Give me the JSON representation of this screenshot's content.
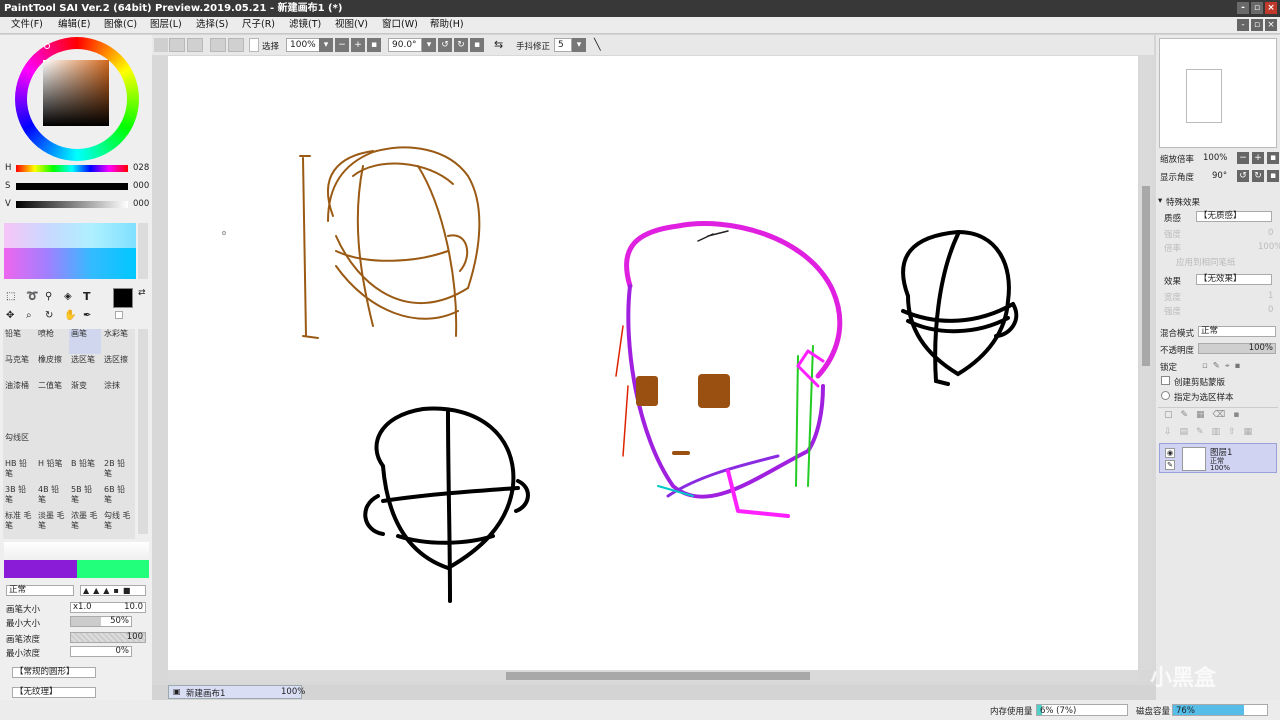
{
  "window": {
    "title": "PaintTool SAI Ver.2 (64bit) Preview.2019.05.21 - 新建画布1 (*)",
    "btn_min": "-",
    "btn_max": "▫",
    "btn_close": "×"
  },
  "menu": [
    "文件(F)",
    "编辑(E)",
    "图像(C)",
    "图层(L)",
    "选择(S)",
    "尺子(R)",
    "滤镜(T)",
    "视图(V)",
    "窗口(W)",
    "帮助(H)"
  ],
  "toolbar": {
    "select_label": "选择",
    "zoom": "100%",
    "rotation": "90.0°",
    "stabilizer_label": "手抖修正",
    "stabilizer": "5"
  },
  "color": {
    "h_label": "H",
    "s_label": "S",
    "v_label": "V",
    "h_value": "028",
    "s_value": "000",
    "v_value": "000"
  },
  "tools": {
    "text_tool": "T",
    "row1": [
      "铅笔",
      "喷枪",
      "画笔",
      "水彩笔"
    ],
    "row2": [
      "马克笔",
      "橡皮擦",
      "选区笔",
      "选区擦"
    ],
    "row3": [
      "油漆桶",
      "二值笔",
      "渐变",
      "涂抹"
    ],
    "row4": [
      "勾线区"
    ],
    "row5": [
      "HB 铅笔",
      "H 铅笔",
      "B 铅笔",
      "2B 铅笔"
    ],
    "row6": [
      "3B 铅笔",
      "4B 铅笔",
      "5B 铅笔",
      "6B 铅笔"
    ],
    "row7": [
      "标准 毛笔",
      "淡墨 毛笔",
      "浓墨 毛笔",
      "勾线 毛笔"
    ]
  },
  "brush": {
    "mode": "正常",
    "size_label": "画笔大小",
    "size_mult": "x1.0",
    "size_value": "10.0",
    "min_size_label": "最小大小",
    "min_size": "50%",
    "density_label": "画笔浓度",
    "density": "100",
    "min_density_label": "最小浓度",
    "min_density": "0%",
    "shape": "【常规的圆形】",
    "texture": "【无纹理】",
    "swatch_colors": [
      "#8a1bd6",
      "#22ff7a"
    ]
  },
  "navigator": {
    "zoom_label": "缩放倍率",
    "zoom": "100%",
    "angle_label": "显示角度",
    "angle": "90°"
  },
  "effects": {
    "header": "特殊效果",
    "texture_label": "质感",
    "texture": "【无质感】",
    "texture_sub": [
      "强度",
      "倍率",
      "应用到相同笔纸"
    ],
    "texture_vals": [
      "0",
      "100%"
    ],
    "effect_label": "效果",
    "effect": "【无效果】",
    "effect_sub": [
      "宽度",
      "强度"
    ],
    "effect_vals": [
      "1",
      "0"
    ]
  },
  "layer": {
    "blend_label": "混合模式",
    "blend": "正常",
    "opacity_label": "不透明度",
    "opacity": "100%",
    "lock_label": "锁定",
    "clip_label": "创建剪贴蒙版",
    "ref_label": "指定为选区样本",
    "name": "图层1",
    "mode": "正常",
    "opacity_small": "100%"
  },
  "document": {
    "tab": "新建画布1",
    "zoom": "100%"
  },
  "status": {
    "memory_label": "内存使用量",
    "memory": "6% (7%)",
    "disk_label": "磁盘容量",
    "disk": "76%",
    "memory_fraction": 0.06,
    "disk_fraction": 0.76
  },
  "watermark": "小黑盒"
}
